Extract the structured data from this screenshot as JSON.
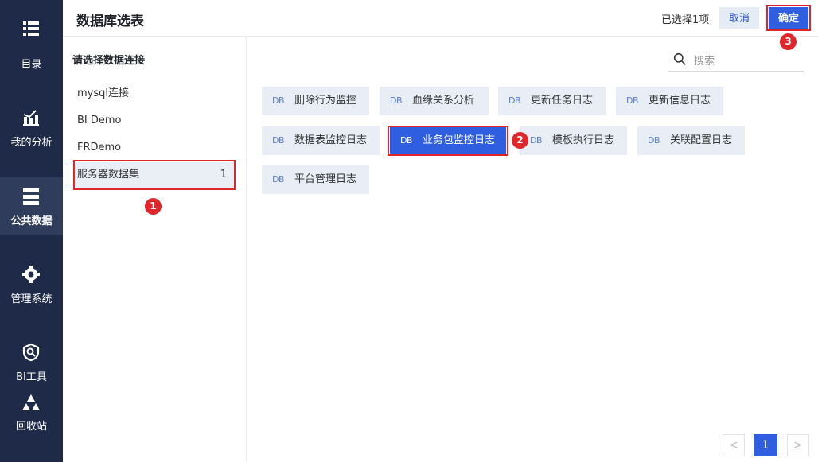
{
  "nav": {
    "items": [
      {
        "label": "目录",
        "icon": "list-icon"
      },
      {
        "label": "我的分析",
        "icon": "analysis-icon"
      },
      {
        "label": "公共数据",
        "icon": "database-icon"
      },
      {
        "label": "管理系统",
        "icon": "gear-icon"
      },
      {
        "label": "BI工具",
        "icon": "tool-icon"
      },
      {
        "label": "回收站",
        "icon": "recycle-icon"
      }
    ],
    "active_index": 2
  },
  "header": {
    "title": "数据库选表",
    "selected_count": "已选择1项",
    "cancel_label": "取消",
    "ok_label": "确定"
  },
  "connections": {
    "heading": "请选择数据连接",
    "items": [
      {
        "label": "mysql连接",
        "count": ""
      },
      {
        "label": "BI Demo",
        "count": ""
      },
      {
        "label": "FRDemo",
        "count": ""
      },
      {
        "label": "服务器数据集",
        "count": "1"
      }
    ]
  },
  "search": {
    "placeholder": "搜索"
  },
  "tables": [
    {
      "db": "DB",
      "name": "删除行为监控"
    },
    {
      "db": "DB",
      "name": "血缘关系分析"
    },
    {
      "db": "DB",
      "name": "更新任务日志"
    },
    {
      "db": "DB",
      "name": "更新信息日志"
    },
    {
      "db": "DB",
      "name": "数据表监控日志"
    },
    {
      "db": "DB",
      "name": "业务包监控日志"
    },
    {
      "db": "DB",
      "name": "模板执行日志"
    },
    {
      "db": "DB",
      "name": "关联配置日志"
    },
    {
      "db": "DB",
      "name": "平台管理日志"
    }
  ],
  "selected_table": "业务包监控日志",
  "badges": [
    "1",
    "2",
    "3"
  ],
  "pagination": {
    "prev": "<",
    "current": "1",
    "next": ">"
  },
  "colors": {
    "nav_bg": "#1e2a47",
    "accent": "#2f5ee0",
    "highlight": "#e0262b",
    "chip_bg": "#e9eef6"
  }
}
